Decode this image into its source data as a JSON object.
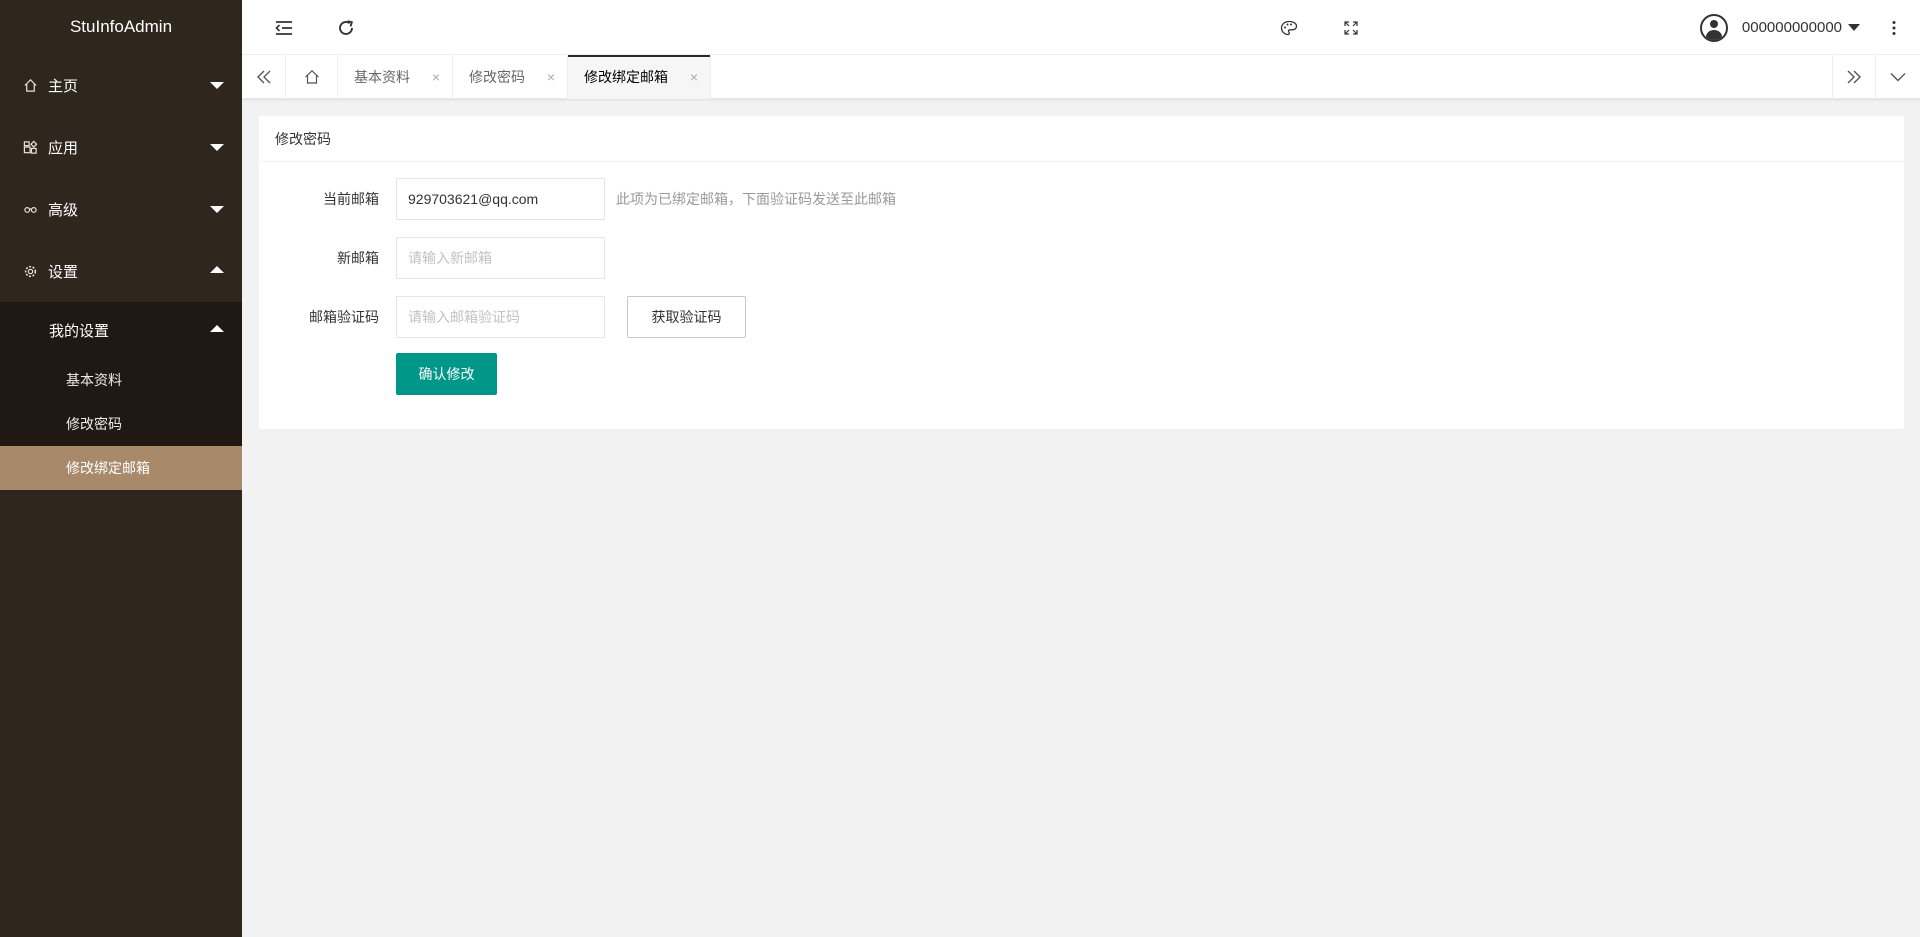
{
  "app": {
    "title": "StuInfoAdmin"
  },
  "sidebar": {
    "items": [
      {
        "label": "主页",
        "icon": "home-icon"
      },
      {
        "label": "应用",
        "icon": "apps-icon"
      },
      {
        "label": "高级",
        "icon": "senior-icon"
      },
      {
        "label": "设置",
        "icon": "gear-icon"
      }
    ],
    "submenu": {
      "label": "我的设置",
      "items": [
        "基本资料",
        "修改密码",
        "修改绑定邮箱"
      ],
      "active_index": 2
    }
  },
  "header": {
    "user_name": "000000000000"
  },
  "tabs": {
    "items": [
      {
        "label": "基本资料",
        "close": "×"
      },
      {
        "label": "修改密码",
        "close": "×"
      },
      {
        "label": "修改绑定邮箱",
        "close": "×"
      }
    ],
    "active_index": 2
  },
  "form": {
    "card_title": "修改密码",
    "current_email": {
      "label": "当前邮箱",
      "value": "929703621@qq.com",
      "tip": "此项为已绑定邮箱，下面验证码发送至此邮箱"
    },
    "new_email": {
      "label": "新邮箱",
      "placeholder": "请输入新邮箱"
    },
    "verify_code": {
      "label": "邮箱验证码",
      "placeholder": "请输入邮箱验证码",
      "button": "获取验证码"
    },
    "submit": "确认修改"
  },
  "colors": {
    "sidebar_bg": "#2f261e",
    "submenu_bg": "#1f1813",
    "active_item": "#a88a6b",
    "primary_button": "#009688"
  }
}
